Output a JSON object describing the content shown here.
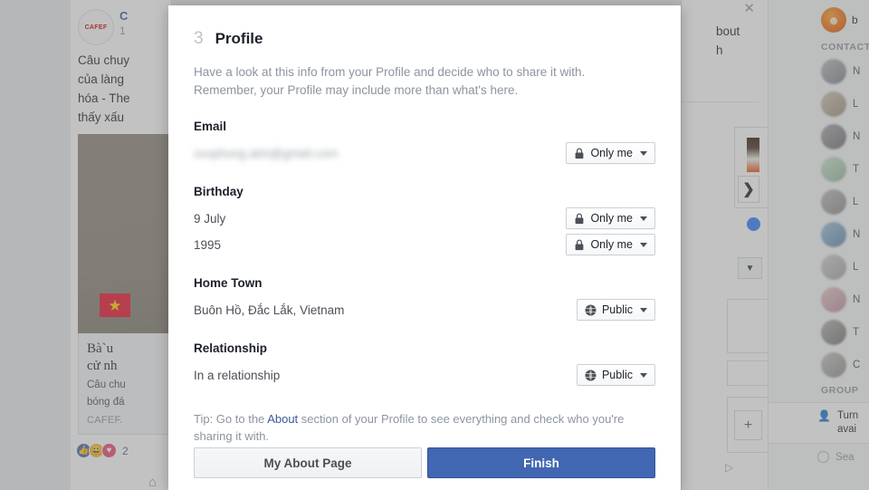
{
  "modal": {
    "step_number": "3",
    "title": "Profile",
    "intro": "Have a look at this info from your Profile and decide who to share it with. Remember, your Profile may include more than what's here.",
    "fields": [
      {
        "label": "Email",
        "rows": [
          {
            "value": "xxxphung.atm@gmail.com",
            "redacted": true,
            "audience": "Only me",
            "audience_icon": "lock-icon"
          }
        ]
      },
      {
        "label": "Birthday",
        "rows": [
          {
            "value": "9 July",
            "redacted": false,
            "audience": "Only me",
            "audience_icon": "lock-icon"
          },
          {
            "value": "1995",
            "redacted": false,
            "audience": "Only me",
            "audience_icon": "lock-icon"
          }
        ]
      },
      {
        "label": "Home Town",
        "rows": [
          {
            "value": "Buôn Hồ, Đắc Lắk, Vietnam",
            "redacted": false,
            "audience": "Public",
            "audience_icon": "globe-icon"
          }
        ]
      },
      {
        "label": "Relationship",
        "rows": [
          {
            "value": "In a relationship",
            "redacted": false,
            "audience": "Public",
            "audience_icon": "globe-icon"
          }
        ]
      }
    ],
    "tip": {
      "before": "Tip: Go to the ",
      "link": "About",
      "after": " section of your Profile to see everything and check who you're sharing it with."
    },
    "buttons": {
      "secondary": "My About Page",
      "primary": "Finish"
    }
  },
  "background": {
    "feed": {
      "page_name": "C",
      "timestamp": "1",
      "post_text_lines": [
        "Câu chuy",
        "của làng",
        "hóa - The",
        "thấy xấu"
      ],
      "logo_text": "CAFEF",
      "link_title_lines": [
        "Bà`u",
        "cử nh"
      ],
      "link_desc_lines": [
        "Câu chu",
        "bóng đá"
      ],
      "link_domain": "CAFEF.",
      "reaction_count": "2"
    },
    "dialog": {
      "close_icon": "close-icon",
      "text_lines": [
        "bout",
        "h"
      ],
      "next_icon": "chevron-right-icon",
      "caret_icon": "chevron-down-icon",
      "plus_icon": "plus-icon",
      "send_icon": "send-icon"
    },
    "chat_sidebar": {
      "me_name": "b",
      "contacts_header": "CONTACTS",
      "contact_labels": [
        "N",
        "L",
        "N",
        "T",
        "L",
        "N",
        "L",
        "N",
        "T",
        "C"
      ],
      "groups_header": "GROUP",
      "notice_icon": "person-available-icon",
      "notice_text": "Turn avai",
      "search_label": "Sea"
    }
  },
  "colors": {
    "primary_button": "#4267b2",
    "link": "#3b5998",
    "muted_text": "#8d949e",
    "body_text": "#1d2129"
  }
}
